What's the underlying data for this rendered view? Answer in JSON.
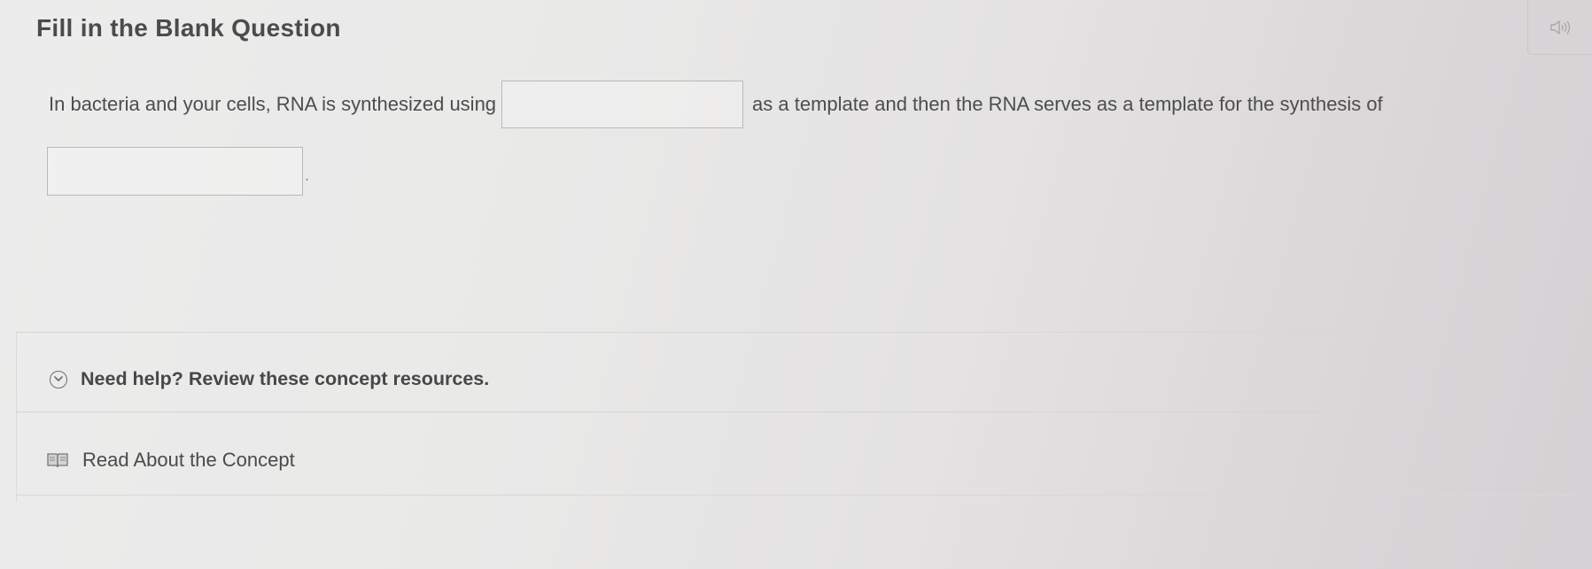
{
  "header": {
    "title": "Fill in the Blank Question",
    "audio_icon": "speaker-icon"
  },
  "question": {
    "text_before_blank1": "In bacteria and your cells, RNA is synthesized using",
    "blank1_value": "",
    "text_after_blank1": "as a template and then the RNA serves as a template for the synthesis of",
    "blank2_value": "",
    "text_after_blank2": "."
  },
  "help": {
    "toggle_label": "Need help? Review these concept resources.",
    "toggle_icon": "chevron-down-circle-icon",
    "resources": [
      {
        "label": "Read About the Concept",
        "icon": "book-icon"
      }
    ]
  },
  "colors": {
    "text": "#4b4b4b",
    "border": "#b9b9b9",
    "background": "#e9e9e8"
  }
}
